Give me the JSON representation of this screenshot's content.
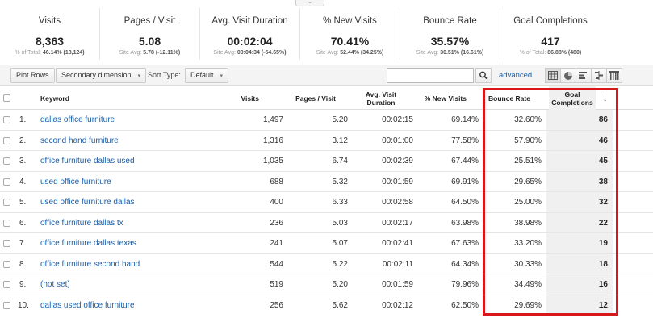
{
  "summary": {
    "metrics": [
      {
        "name": "Visits",
        "value": "8,363",
        "sub_label": "% of Total:",
        "sub_value": "46.14% (18,124)"
      },
      {
        "name": "Pages / Visit",
        "value": "5.08",
        "sub_label": "Site Avg:",
        "sub_value": "5.78 (-12.11%)"
      },
      {
        "name": "Avg. Visit Duration",
        "value": "00:02:04",
        "sub_label": "Site Avg:",
        "sub_value": "00:04:34 (-54.65%)"
      },
      {
        "name": "% New Visits",
        "value": "70.41%",
        "sub_label": "Site Avg:",
        "sub_value": "52.44% (34.25%)"
      },
      {
        "name": "Bounce Rate",
        "value": "35.57%",
        "sub_label": "Site Avg:",
        "sub_value": "30.51% (16.61%)"
      },
      {
        "name": "Goal Completions",
        "value": "417",
        "sub_label": "% of Total:",
        "sub_value": "86.88% (480)"
      }
    ]
  },
  "toolbar": {
    "plot_rows": "Plot Rows",
    "secondary_dimension": "Secondary dimension",
    "sort_type_label": "Sort Type:",
    "sort_type_value": "Default",
    "search_value": "",
    "advanced": "advanced",
    "view_icons": [
      "grid-view-icon",
      "pie-view-icon",
      "performance-view-icon",
      "comparison-view-icon",
      "pivot-view-icon"
    ]
  },
  "table": {
    "headers": {
      "keyword": "Keyword",
      "visits": "Visits",
      "pages_visit": "Pages / Visit",
      "avg_duration": "Avg. Visit Duration",
      "new_visits": "% New Visits",
      "bounce_rate": "Bounce Rate",
      "goal_completions": "Goal Completions",
      "sort_indicator": "↓"
    },
    "rows": [
      {
        "num": "1.",
        "keyword": "dallas office furniture",
        "visits": "1,497",
        "pages": "5.20",
        "duration": "00:02:15",
        "new": "69.14%",
        "bounce": "32.60%",
        "goals": "86"
      },
      {
        "num": "2.",
        "keyword": "second hand furniture",
        "visits": "1,316",
        "pages": "3.12",
        "duration": "00:01:00",
        "new": "77.58%",
        "bounce": "57.90%",
        "goals": "46"
      },
      {
        "num": "3.",
        "keyword": "office furniture dallas used",
        "visits": "1,035",
        "pages": "6.74",
        "duration": "00:02:39",
        "new": "67.44%",
        "bounce": "25.51%",
        "goals": "45"
      },
      {
        "num": "4.",
        "keyword": "used office furniture",
        "visits": "688",
        "pages": "5.32",
        "duration": "00:01:59",
        "new": "69.91%",
        "bounce": "29.65%",
        "goals": "38"
      },
      {
        "num": "5.",
        "keyword": "used office furniture dallas",
        "visits": "400",
        "pages": "6.33",
        "duration": "00:02:58",
        "new": "64.50%",
        "bounce": "25.00%",
        "goals": "32"
      },
      {
        "num": "6.",
        "keyword": "office furniture dallas tx",
        "visits": "236",
        "pages": "5.03",
        "duration": "00:02:17",
        "new": "63.98%",
        "bounce": "38.98%",
        "goals": "22"
      },
      {
        "num": "7.",
        "keyword": "office furniture dallas texas",
        "visits": "241",
        "pages": "5.07",
        "duration": "00:02:41",
        "new": "67.63%",
        "bounce": "33.20%",
        "goals": "19"
      },
      {
        "num": "8.",
        "keyword": "office furniture second hand",
        "visits": "544",
        "pages": "5.22",
        "duration": "00:02:11",
        "new": "64.34%",
        "bounce": "30.33%",
        "goals": "18"
      },
      {
        "num": "9.",
        "keyword": "(not set)",
        "visits": "519",
        "pages": "5.20",
        "duration": "00:01:59",
        "new": "79.96%",
        "bounce": "34.49%",
        "goals": "16"
      },
      {
        "num": "10.",
        "keyword": "dallas used office furniture",
        "visits": "256",
        "pages": "5.62",
        "duration": "00:02:12",
        "new": "62.50%",
        "bounce": "29.69%",
        "goals": "12"
      }
    ]
  },
  "colors": {
    "highlight": "#d8171b",
    "link": "#1a5ea8"
  }
}
